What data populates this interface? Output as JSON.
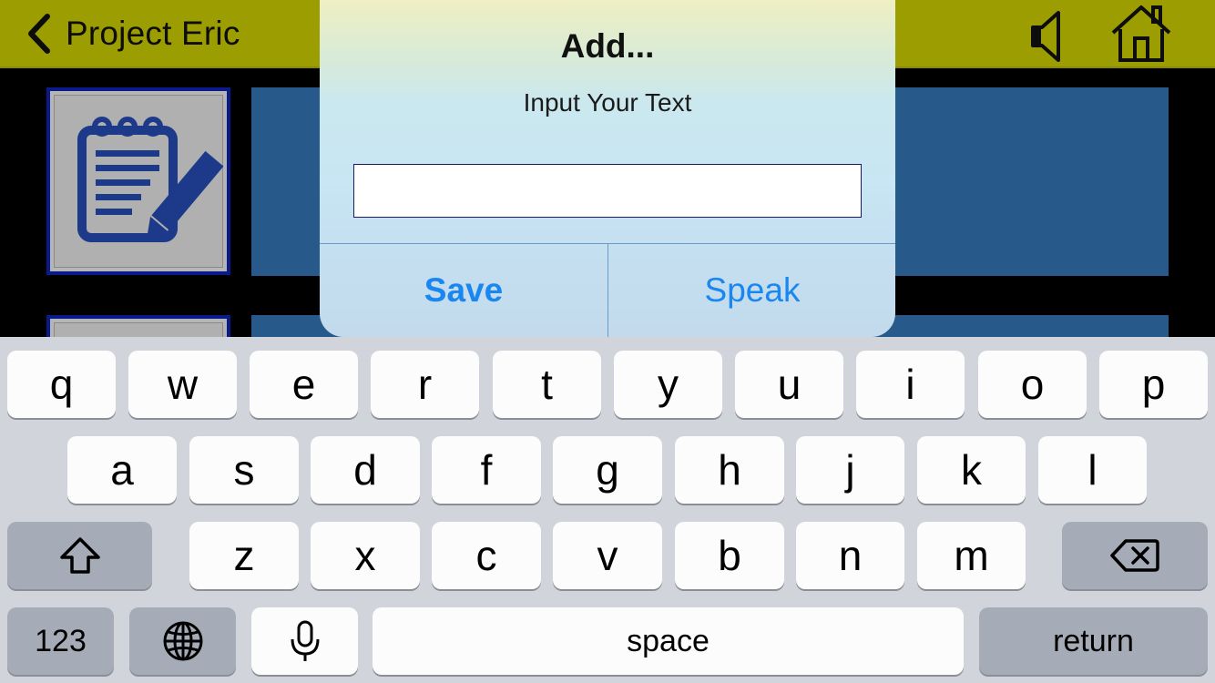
{
  "navbar": {
    "back_label": "Project Eric",
    "bg_color": "#9c9d00",
    "icons": [
      "chevron-left-icon",
      "speaker-icon",
      "home-icon"
    ]
  },
  "content": {
    "tile_icon": "notepad-pencil-icon",
    "bar_color": "#275a8a"
  },
  "dialog": {
    "title": "Add...",
    "message": "Input Your Text",
    "input_value": "",
    "save_label": "Save",
    "speak_label": "Speak",
    "button_color": "#1a86f0"
  },
  "keyboard": {
    "row1": [
      "q",
      "w",
      "e",
      "r",
      "t",
      "y",
      "u",
      "i",
      "o",
      "p"
    ],
    "row2": [
      "a",
      "s",
      "d",
      "f",
      "g",
      "h",
      "j",
      "k",
      "l"
    ],
    "row3": [
      "z",
      "x",
      "c",
      "v",
      "b",
      "n",
      "m"
    ],
    "numbers_label": "123",
    "space_label": "space",
    "return_label": "return",
    "icons": [
      "shift-icon",
      "backspace-icon",
      "globe-icon",
      "microphone-icon"
    ]
  }
}
